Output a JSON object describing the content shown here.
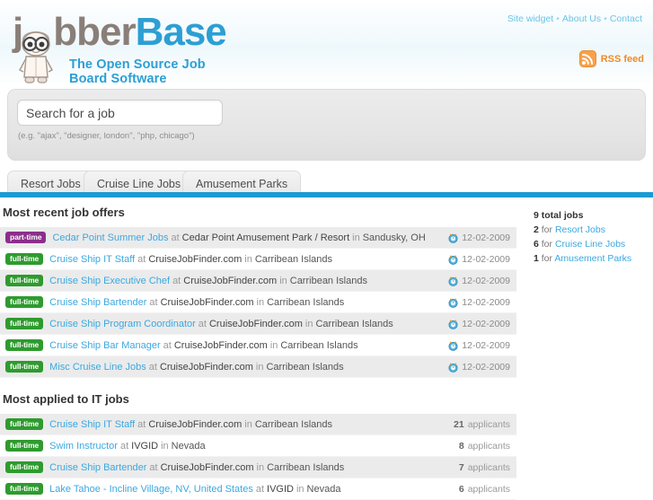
{
  "header": {
    "logo": {
      "part1": "j",
      "part2": "bber",
      "part3": "Base"
    },
    "tagline": "The Open Source Job Board Software",
    "nav": [
      {
        "label": "Site widget"
      },
      {
        "label": "About Us"
      },
      {
        "label": "Contact"
      }
    ],
    "nav_separator": "•",
    "rss_label": "RSS feed"
  },
  "search": {
    "placeholder": "Search for a job",
    "value": "",
    "hint": "(e.g. \"ajax\", \"designer, london\", \"php, chicago\")"
  },
  "tabs": [
    {
      "label": "Resort Jobs",
      "active": false
    },
    {
      "label": "Cruise Line Jobs",
      "active": false
    },
    {
      "label": "Amusement Parks",
      "active": false
    }
  ],
  "sections": {
    "recent": {
      "title": "Most recent job offers",
      "rows": [
        {
          "badge": "part-time",
          "badge_type": "part-time",
          "title": "Cedar Point Summer Jobs",
          "at": "at",
          "company": "Cedar Point Amusement Park / Resort",
          "in": "in",
          "location": "Sandusky, OH",
          "date": "12-02-2009"
        },
        {
          "badge": "full-time",
          "badge_type": "full-time",
          "title": "Cruise Ship IT Staff",
          "at": "at",
          "company": "CruiseJobFinder.com",
          "in": "in",
          "location": "Carribean Islands",
          "date": "12-02-2009"
        },
        {
          "badge": "full-time",
          "badge_type": "full-time",
          "title": "Cruise Ship Executive Chef",
          "at": "at",
          "company": "CruiseJobFinder.com",
          "in": "in",
          "location": "Carribean Islands",
          "date": "12-02-2009"
        },
        {
          "badge": "full-time",
          "badge_type": "full-time",
          "title": "Cruise Ship Bartender",
          "at": "at",
          "company": "CruiseJobFinder.com",
          "in": "in",
          "location": "Carribean Islands",
          "date": "12-02-2009"
        },
        {
          "badge": "full-time",
          "badge_type": "full-time",
          "title": "Cruise Ship Program Coordinator",
          "at": "at",
          "company": "CruiseJobFinder.com",
          "in": "in",
          "location": "Carribean Islands",
          "date": "12-02-2009"
        },
        {
          "badge": "full-time",
          "badge_type": "full-time",
          "title": "Cruise Ship Bar Manager",
          "at": "at",
          "company": "CruiseJobFinder.com",
          "in": "in",
          "location": "Carribean Islands",
          "date": "12-02-2009"
        },
        {
          "badge": "full-time",
          "badge_type": "full-time",
          "title": "Misc Cruise Line Jobs",
          "at": "at",
          "company": "CruiseJobFinder.com",
          "in": "in",
          "location": "Carribean Islands",
          "date": "12-02-2009"
        }
      ]
    },
    "applied": {
      "title": "Most applied to IT jobs",
      "applicants_word": "applicants",
      "rows": [
        {
          "badge": "full-time",
          "badge_type": "full-time",
          "title": "Cruise Ship IT Staff",
          "at": "at",
          "company": "CruiseJobFinder.com",
          "in": "in",
          "location": "Carribean Islands",
          "applicants": "21"
        },
        {
          "badge": "full-time",
          "badge_type": "full-time",
          "title": "Swim Instructor",
          "at": "at",
          "company": "IVGID",
          "in": "in",
          "location": "Nevada",
          "applicants": "8"
        },
        {
          "badge": "full-time",
          "badge_type": "full-time",
          "title": "Cruise Ship Bartender",
          "at": "at",
          "company": "CruiseJobFinder.com",
          "in": "in",
          "location": "Carribean Islands",
          "applicants": "7"
        },
        {
          "badge": "full-time",
          "badge_type": "full-time",
          "title": "Lake Tahoe - Incline Village, NV, United States",
          "at": "at",
          "company": "IVGID",
          "in": "in",
          "location": "Nevada",
          "applicants": "6"
        }
      ]
    }
  },
  "sidebar": {
    "total_label": "9 total jobs",
    "items": [
      {
        "count": "2",
        "for": "for",
        "label": "Resort Jobs"
      },
      {
        "count": "6",
        "for": "for",
        "label": "Cruise Line Jobs"
      },
      {
        "count": "1",
        "for": "for",
        "label": "Amusement Parks"
      }
    ]
  },
  "colors": {
    "brand_blue": "#2c9fd4",
    "bar_blue": "#1b9ad1",
    "link_blue": "#3aa8e0",
    "full_time_green": "#2e9b2e",
    "part_time_purple": "#8b2e8b",
    "rss_orange": "#f08a28"
  }
}
